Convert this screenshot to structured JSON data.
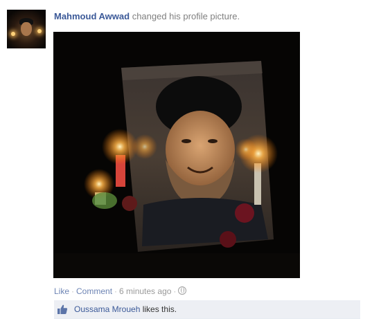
{
  "story": {
    "actor_name": "Mahmoud Awwad",
    "action_text": "changed his profile picture."
  },
  "meta": {
    "like_label": "Like",
    "comment_label": "Comment",
    "separator": "·",
    "timestamp": "6 minutes ago"
  },
  "likes": {
    "liker_name": "Oussama Mroueh",
    "suffix": "likes this."
  },
  "colors": {
    "link_blue": "#3b5998",
    "muted_gray": "#7f7f7f",
    "likes_bg": "#edeff4"
  },
  "icons": {
    "privacy": "globe-icon",
    "like": "thumbs-up-icon"
  }
}
